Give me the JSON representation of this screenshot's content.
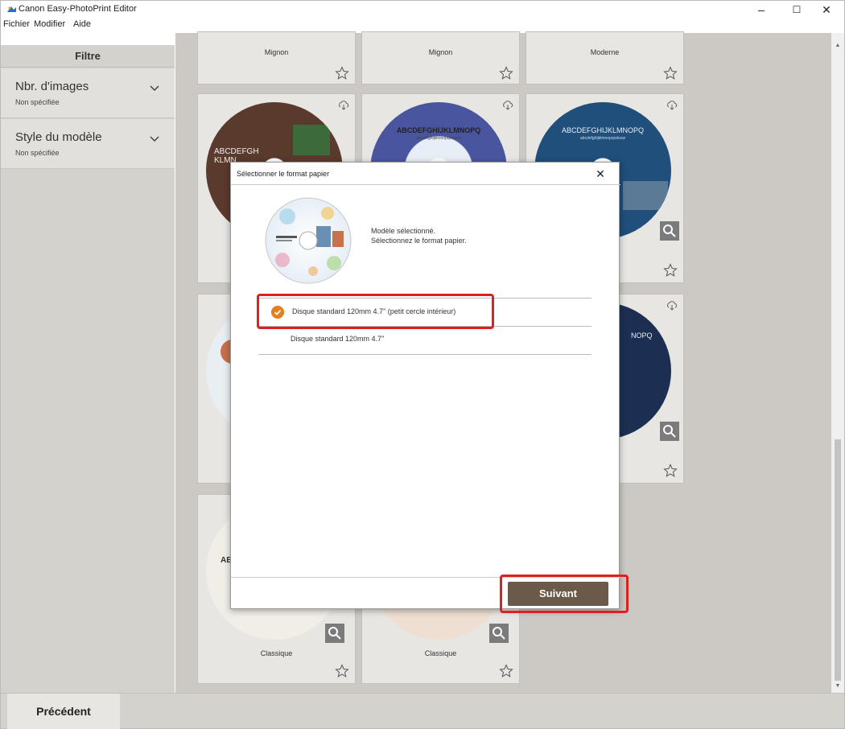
{
  "window": {
    "title": "Canon Easy-PhotoPrint Editor",
    "minimize": "–",
    "maximize": "☐",
    "close": "✕"
  },
  "menu": [
    "Fichier",
    "Modifier",
    "Aide"
  ],
  "sidebar": {
    "header": "Filtre",
    "filters": [
      {
        "title": "Nbr. d'images",
        "value": "Non spécifiée"
      },
      {
        "title": "Style du modèle",
        "value": "Non spécifiée"
      }
    ]
  },
  "cards": {
    "top_labels": [
      "Mignon",
      "Mignon",
      "Moderne"
    ],
    "bottom_labels": [
      "Classique",
      "Classique"
    ],
    "disc_texts": {
      "disc1": "ABCDEFGH\nKLMN",
      "disc2": "ABCDEFGHIJKLMNOPQ",
      "disc2_sub": "abcdefghijklmnopqrstuvw",
      "disc3": "ABCDEFGHIJKLMNOPQ",
      "disc3_sub": "abcdefghijklmnopqrstuvw",
      "disc4": "NOPQ",
      "disc5": "ABC"
    }
  },
  "modal": {
    "title": "Sélectionner le format papier",
    "close": "✕",
    "message_line1": "Modèle sélectionné.",
    "message_line2": "Sélectionnez le format papier.",
    "options": [
      {
        "label": "Disque standard 120mm 4.7\" (petit cercle intérieur)",
        "selected": true
      },
      {
        "label": "Disque standard 120mm 4.7\"",
        "selected": false
      }
    ],
    "next_button": "Suivant"
  },
  "footer": {
    "prev_button": "Précédent"
  },
  "colors": {
    "accent_orange": "#e67e22",
    "highlight_red": "#e02020",
    "next_button_bg": "#6b5a4a"
  }
}
